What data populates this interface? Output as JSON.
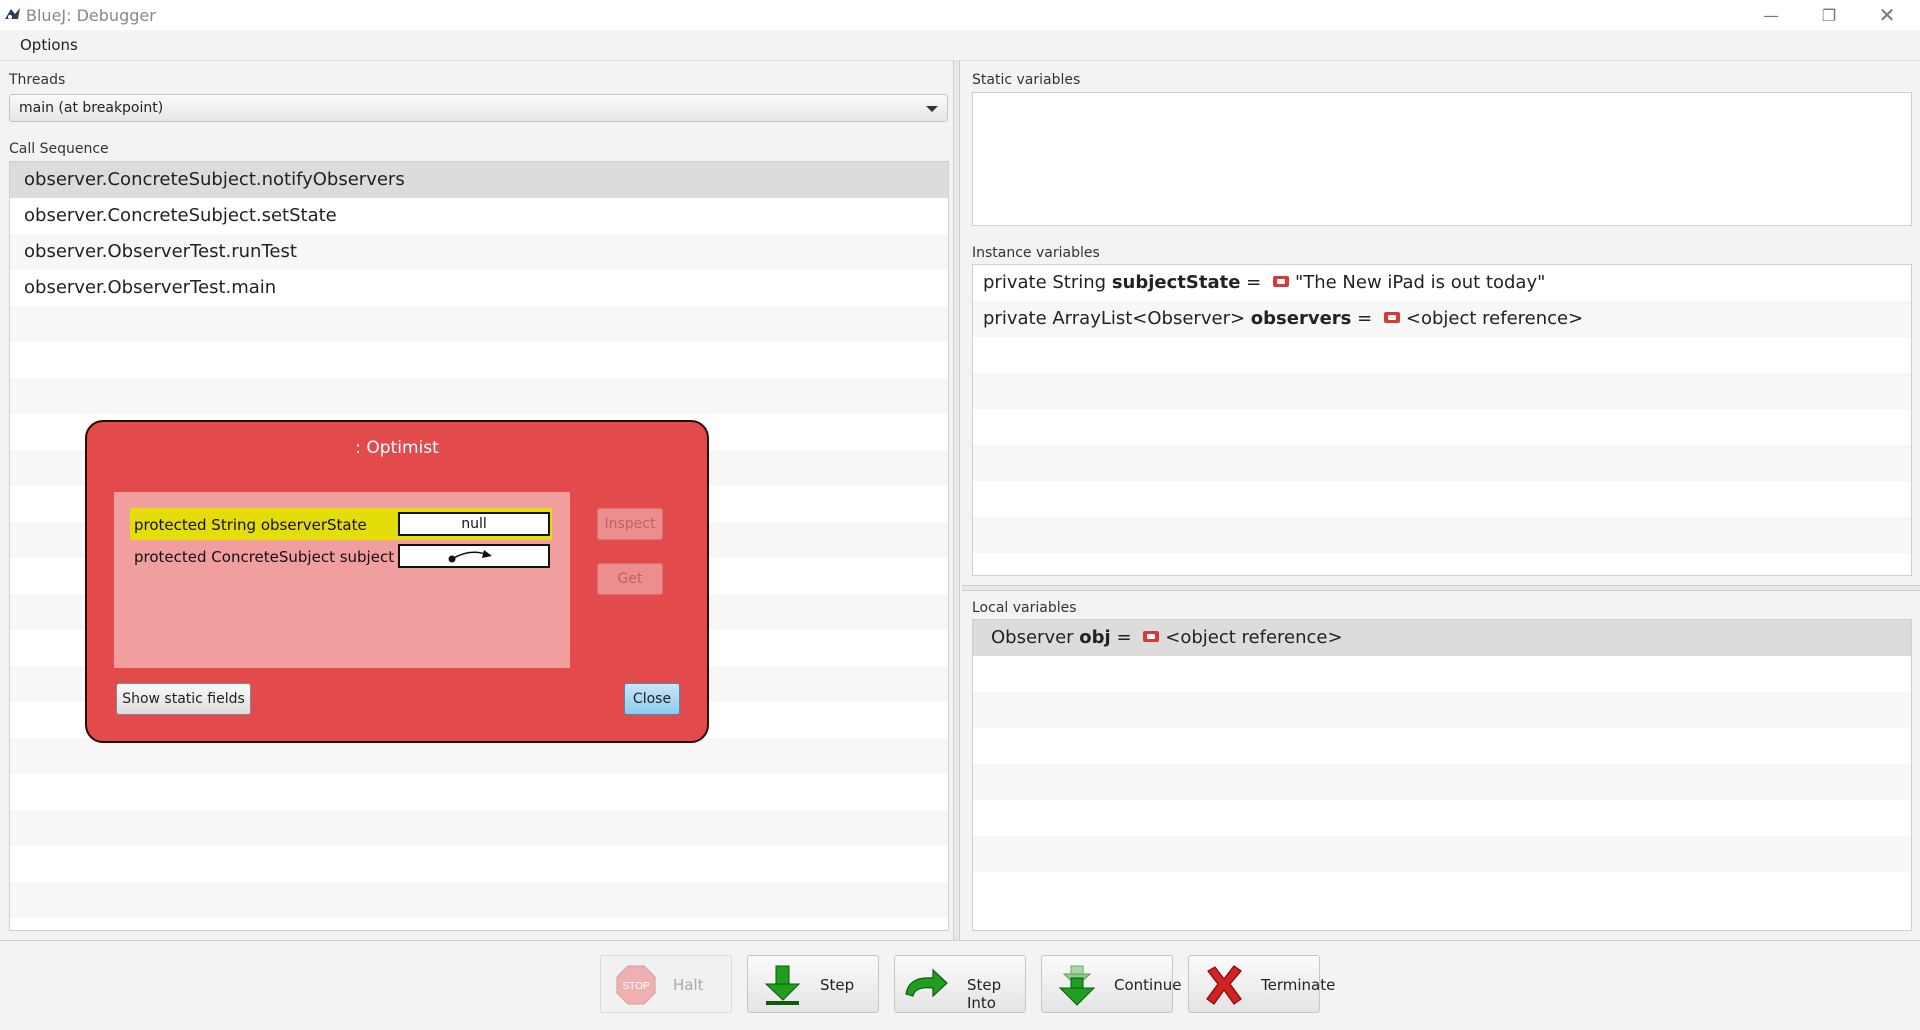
{
  "window": {
    "title": "BlueJ:  Debugger",
    "controls": [
      "minimize-icon",
      "restore-icon",
      "close-icon"
    ]
  },
  "menu": {
    "options_label": "Options"
  },
  "threads": {
    "label": "Threads",
    "selected": "main (at breakpoint)"
  },
  "call_sequence": {
    "label": "Call Sequence",
    "items": [
      "observer.ConcreteSubject.notifyObservers",
      "observer.ConcreteSubject.setState",
      "observer.ObserverTest.runTest",
      "observer.ObserverTest.main"
    ]
  },
  "static_variables": {
    "label": "Static variables"
  },
  "instance_variables": {
    "label": "Instance variables",
    "items": [
      {
        "prefix": "private  String ",
        "name": "subjectState",
        "eq": " = ",
        "value": "\"The New iPad is out today\""
      },
      {
        "prefix": "private  ArrayList<Observer> ",
        "name": "observers",
        "eq": " = ",
        "value": "<object reference>"
      }
    ]
  },
  "local_variables": {
    "label": "Local variables",
    "items": [
      {
        "prefix": "Observer  ",
        "name": "obj",
        "eq": " = ",
        "value": "<object reference>"
      }
    ]
  },
  "inspector": {
    "title": ": Optimist",
    "fields": [
      {
        "label": "protected String observerState",
        "value": "null"
      },
      {
        "label": "protected ConcreteSubject subject",
        "value": ""
      }
    ],
    "inspect_label": "Inspect",
    "get_label": "Get",
    "show_static_label": "Show static fields",
    "close_label": "Close"
  },
  "toolbar": {
    "halt_label": "Halt",
    "halt_icon_text": "STOP",
    "step_label": "Step",
    "step_into_label": "Step Into",
    "continue_label": "Continue",
    "terminate_label": "Terminate"
  },
  "colors": {
    "inspector_bg": "#e24a4b",
    "field_area": "#f19e9e",
    "highlight": "#e4dd0a",
    "accent_green": "#1f9e1f"
  }
}
